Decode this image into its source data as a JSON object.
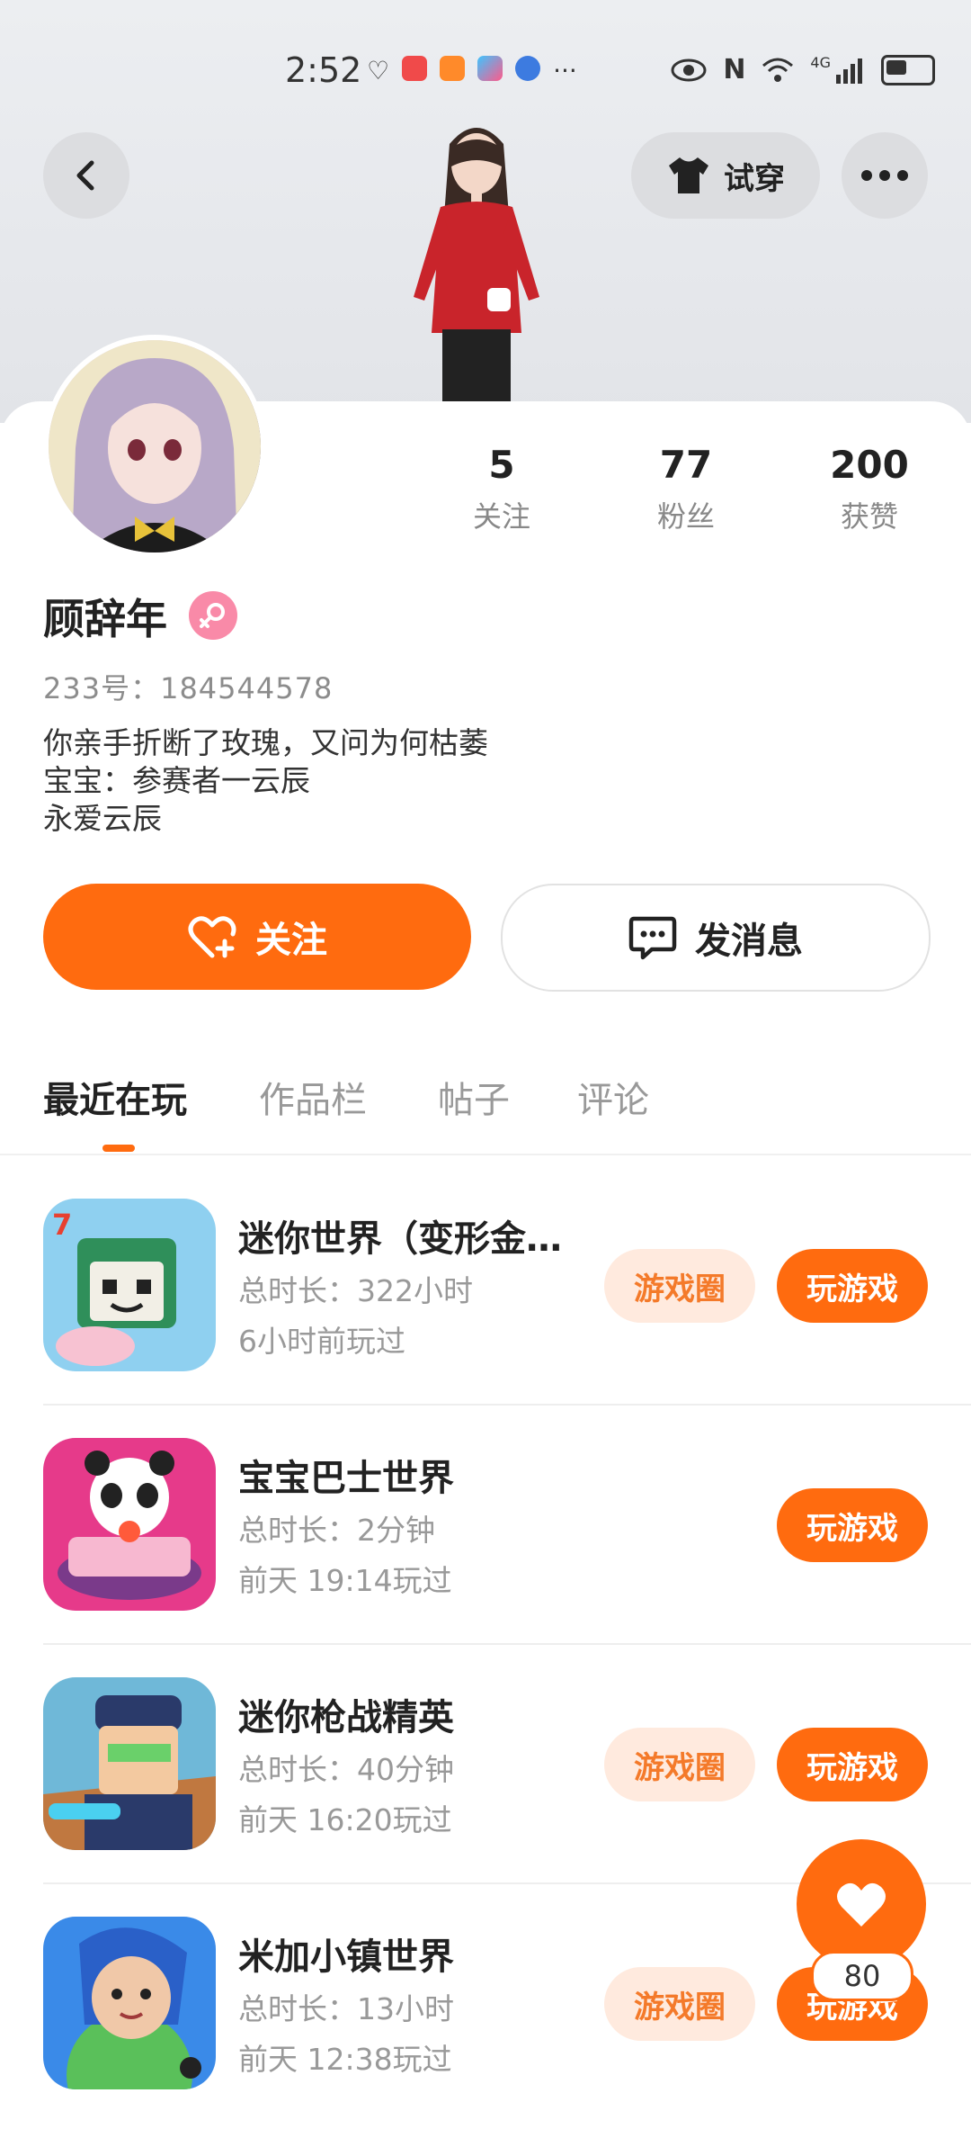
{
  "status_bar": {
    "time": "2:52",
    "network": "4G"
  },
  "header": {
    "try_on_label": "试穿"
  },
  "stats": [
    {
      "value": "5",
      "label": "关注"
    },
    {
      "value": "77",
      "label": "粉丝"
    },
    {
      "value": "200",
      "label": "获赞"
    }
  ],
  "profile": {
    "name": "顾辞年",
    "id_line": "233号：184544578",
    "bio": [
      "你亲手折断了玫瑰，又问为何枯萎",
      "宝宝：参赛者一云辰",
      "永爱云辰"
    ]
  },
  "actions": {
    "follow_label": "关注",
    "message_label": "发消息"
  },
  "tabs": [
    "最近在玩",
    "作品栏",
    "帖子",
    "评论"
  ],
  "games": [
    {
      "title": "迷你世界（变形金…",
      "duration": "总时长：322小时",
      "last_played": "6小时前玩过",
      "circle_label": "游戏圈",
      "play_label": "玩游戏"
    },
    {
      "title": "宝宝巴士世界",
      "duration": "总时长：2分钟",
      "last_played": "前天 19:14玩过",
      "circle_label": "",
      "play_label": "玩游戏"
    },
    {
      "title": "迷你枪战精英",
      "duration": "总时长：40分钟",
      "last_played": "前天 16:20玩过",
      "circle_label": "游戏圈",
      "play_label": "玩游戏"
    },
    {
      "title": "米加小镇世界",
      "duration": "总时长：13小时",
      "last_played": "前天 12:38玩过",
      "circle_label": "游戏圈",
      "play_label": "玩游戏"
    }
  ],
  "fab": {
    "count": "80"
  },
  "colors": {
    "accent": "#ff6b0f",
    "circle_bg": "#ffeade",
    "circle_text": "#f47a2a",
    "gender": "#f98aa8"
  }
}
